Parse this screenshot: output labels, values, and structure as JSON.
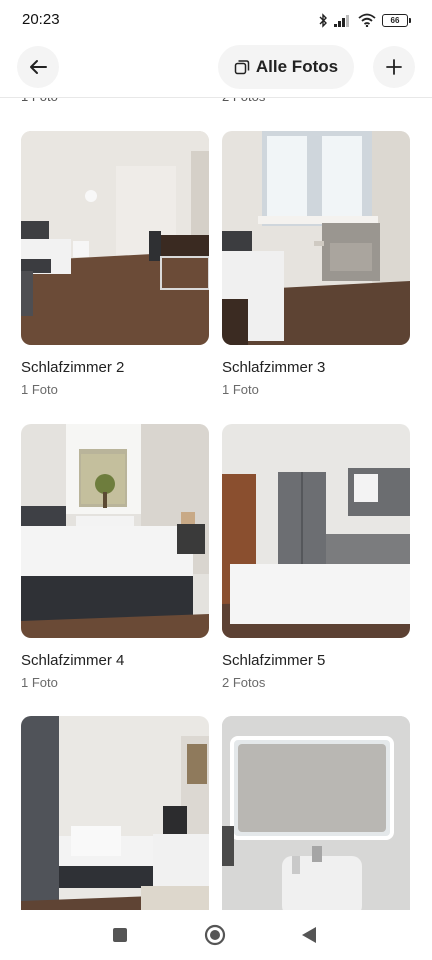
{
  "status_bar": {
    "time": "20:23",
    "battery": "66"
  },
  "header": {
    "all_photos_label": "Alle Fotos"
  },
  "peek_row": {
    "left_count": "1 Foto",
    "right_count": "2 Fotos"
  },
  "gallery": [
    {
      "title": "Schlafzimmer 2",
      "count": "1 Foto"
    },
    {
      "title": "Schlafzimmer 3",
      "count": "1 Foto"
    },
    {
      "title": "Schlafzimmer 4",
      "count": "1 Foto"
    },
    {
      "title": "Schlafzimmer 5",
      "count": "2 Fotos"
    },
    {
      "title": "",
      "count": ""
    },
    {
      "title": "",
      "count": ""
    }
  ],
  "icons": {
    "back": "arrow-left-icon",
    "all_photos": "photos-stack-icon",
    "add": "plus-icon",
    "bluetooth": "bluetooth-icon",
    "signal": "signal-icon",
    "wifi": "wifi-icon",
    "battery": "battery-icon"
  }
}
